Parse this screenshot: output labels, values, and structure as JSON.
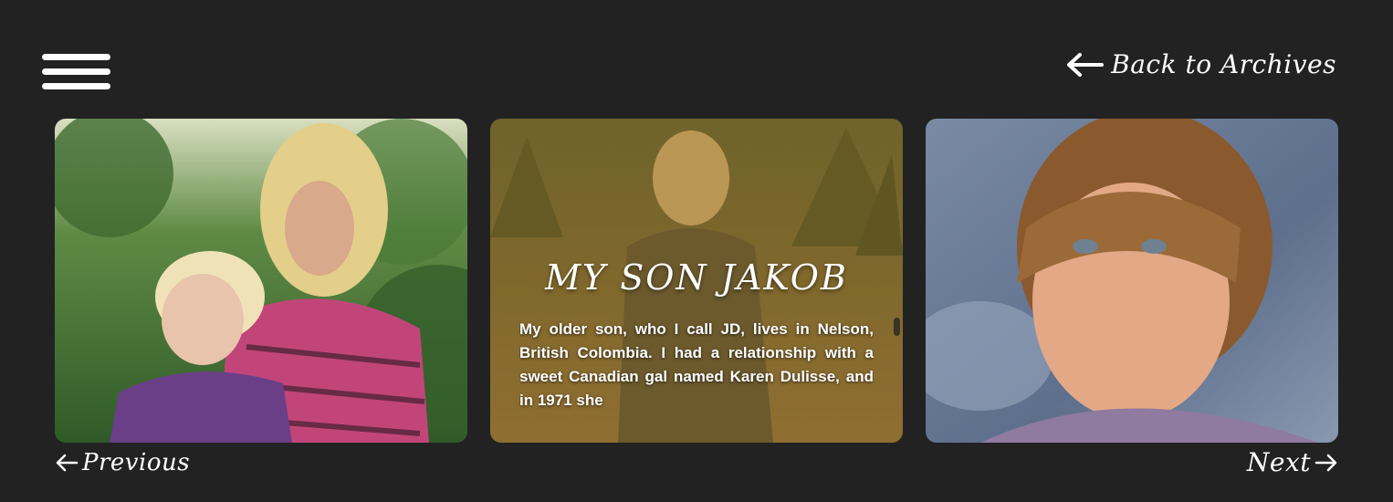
{
  "nav": {
    "back_label": "Back to Archives",
    "menu_icon": "hamburger-menu-icon",
    "back_icon": "arrow-left-icon"
  },
  "cards": {
    "center": {
      "title": "MY SON JAKOB",
      "body": "My older son, who I call JD, lives in Nelson, British Colombia. I had a relationship with a sweet Canadian gal named Karen Dulisse, and in 1971 she"
    }
  },
  "pager": {
    "previous_label": "Previous",
    "next_label": "Next"
  },
  "colors": {
    "background": "#222222",
    "text": "#ffffff",
    "overlay_tint": "#966e28"
  }
}
